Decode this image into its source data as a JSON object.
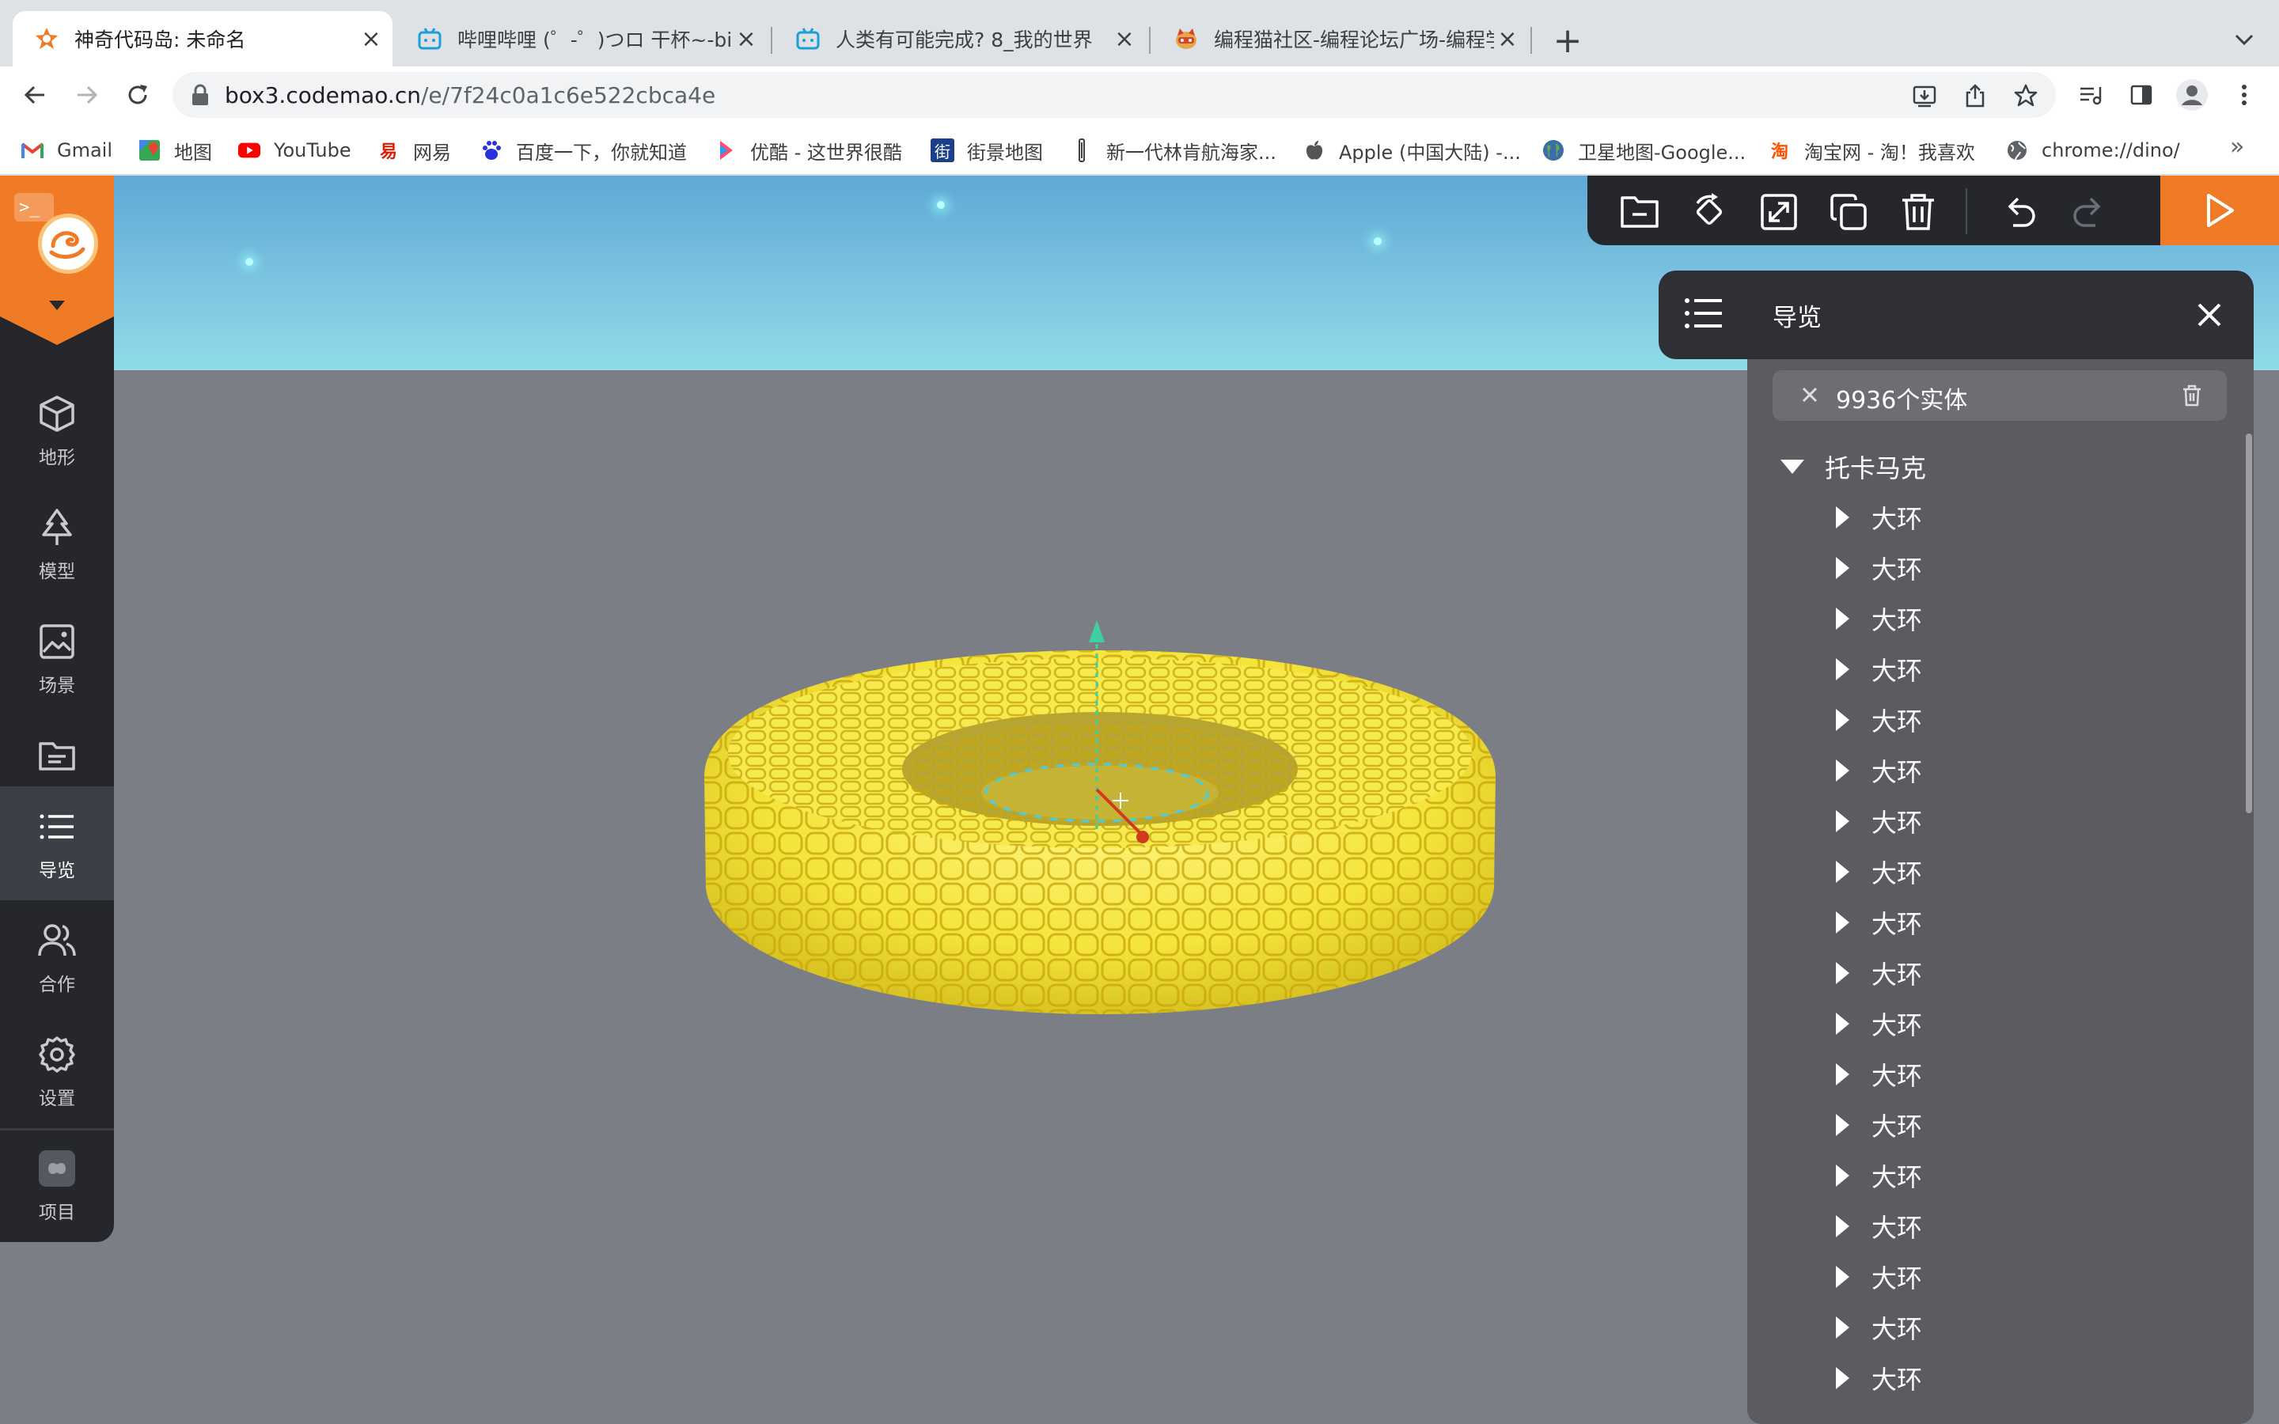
{
  "browser": {
    "tabs": [
      {
        "title": "神奇代码岛: 未命名",
        "active": true
      },
      {
        "title": "哔哩哔哩 (゜-゜)つロ 干杯~-bilibili",
        "active": false
      },
      {
        "title": "人类有可能完成? 8_我的世界",
        "active": false
      },
      {
        "title": "编程猫社区-编程论坛广场-编程学习",
        "active": false
      }
    ],
    "url_host": "box3.codemao.cn",
    "url_path": "/e/7f24c0a1c6e522cbca4e",
    "bookmarks": [
      {
        "label": "Gmail",
        "icon": "gmail-icon"
      },
      {
        "label": "地图",
        "icon": "maps-icon"
      },
      {
        "label": "YouTube",
        "icon": "youtube-icon"
      },
      {
        "label": "网易",
        "icon": "netease-icon"
      },
      {
        "label": "百度一下，你就知道",
        "icon": "baidu-icon"
      },
      {
        "label": "优酷 - 这世界很酷",
        "icon": "youku-icon"
      },
      {
        "label": "街景地图",
        "icon": "streetview-icon"
      },
      {
        "label": "新一代林肯航海家...",
        "icon": "lincoln-icon"
      },
      {
        "label": "Apple (中国大陆) -...",
        "icon": "apple-icon"
      },
      {
        "label": "卫星地图-Google...",
        "icon": "globe-icon"
      },
      {
        "label": "淘宝网 - 淘！我喜欢",
        "icon": "taobao-icon"
      },
      {
        "label": "chrome://dino/",
        "icon": "world-icon"
      }
    ],
    "bookmarks_more": "»"
  },
  "sidebar": {
    "items": [
      {
        "label": "地形",
        "icon": "cube-icon"
      },
      {
        "label": "模型",
        "icon": "tree-icon"
      },
      {
        "label": "场景",
        "icon": "image-icon"
      },
      {
        "label": "文件",
        "icon": "folder-icon"
      },
      {
        "label": "导览",
        "icon": "list-icon",
        "active": true
      },
      {
        "label": "合作",
        "icon": "users-icon"
      },
      {
        "label": "设置",
        "icon": "gear-icon"
      },
      {
        "label": "项目",
        "icon": "project-icon"
      }
    ]
  },
  "nav_panel": {
    "title": "导览",
    "search_value": "9936个实体",
    "root_label": "托卡马克",
    "items": [
      "大环",
      "大环",
      "大环",
      "大环",
      "大环",
      "大环",
      "大环",
      "大环",
      "大环",
      "大环",
      "大环",
      "大环",
      "大环",
      "大环",
      "大环",
      "大环",
      "大环",
      "大环"
    ]
  },
  "colors": {
    "accent": "#f07a26",
    "sidebar_bg": "#25272c",
    "torus": "#f5e43a",
    "ground": "#7c7e86",
    "sky": "#7cc4e0"
  }
}
